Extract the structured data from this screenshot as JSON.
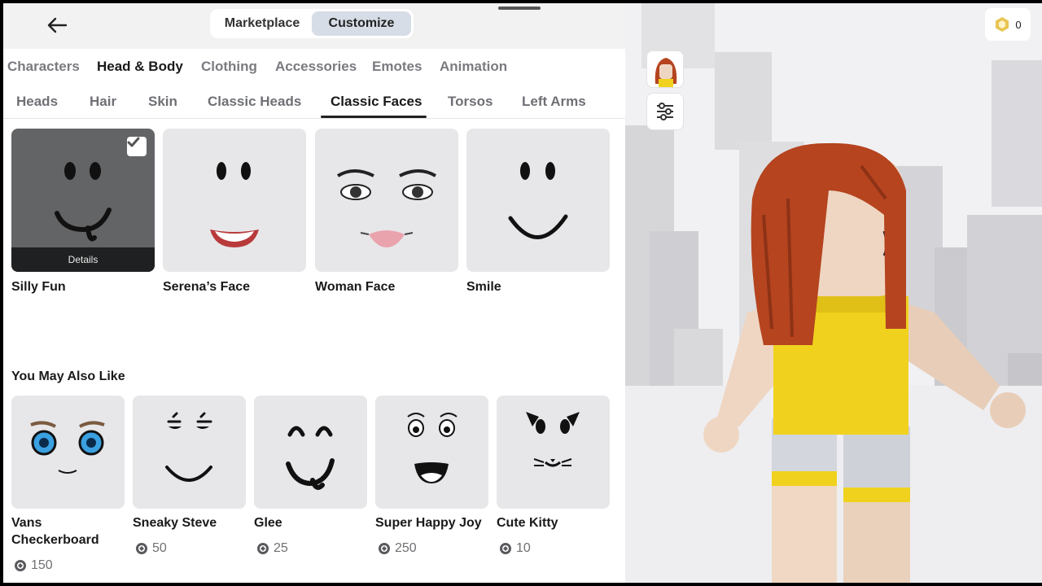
{
  "topbar": {
    "tabs": [
      "Marketplace",
      "Customize"
    ],
    "active_tab": "Customize"
  },
  "categories": [
    "Characters",
    "Head & Body",
    "Clothing",
    "Accessories",
    "Emotes",
    "Animation"
  ],
  "active_category": "Head & Body",
  "subcategories": [
    "Heads",
    "Hair",
    "Skin",
    "Classic Heads",
    "Classic Faces",
    "Torsos",
    "Left Arms"
  ],
  "active_subcategory": "Classic Faces",
  "owned": [
    {
      "name": "Silly Fun",
      "selected": true,
      "details_label": "Details"
    },
    {
      "name": "Serena’s Face"
    },
    {
      "name": "Woman Face"
    },
    {
      "name": "Smile"
    }
  ],
  "recommend": {
    "title": "You May Also Like",
    "items": [
      {
        "name_line1": "Vans",
        "name_line2": "Checkerboard",
        "price": "150"
      },
      {
        "name": "Sneaky Steve",
        "price": "50"
      },
      {
        "name": "Glee",
        "price": "25"
      },
      {
        "name": "Super Happy Joy",
        "price": "250"
      },
      {
        "name": "Cute Kitty",
        "price": "10"
      }
    ]
  },
  "robux": {
    "balance": "0"
  },
  "colors": {
    "accent": "#d7dde6",
    "selected_card": "#636466",
    "card_bg": "#e7e7ea",
    "hair": "#b5441f",
    "shirt": "#f0d21e"
  },
  "icons": [
    "back-arrow-icon",
    "check-icon",
    "robux-icon",
    "sliders-icon",
    "avatar-thumbnail"
  ]
}
